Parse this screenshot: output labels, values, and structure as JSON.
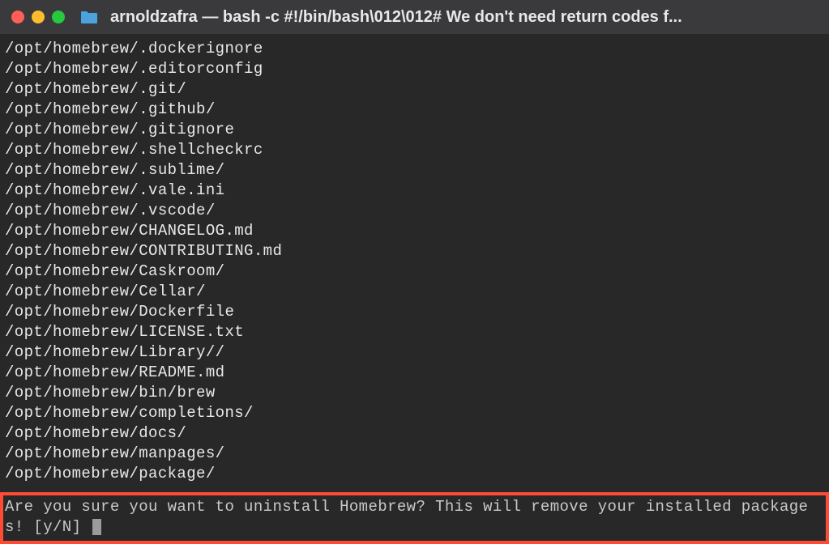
{
  "window": {
    "title": "arnoldzafra — bash -c #!/bin/bash\\012\\012# We don't need return codes f..."
  },
  "terminal": {
    "lines": [
      "/opt/homebrew/.dockerignore",
      "/opt/homebrew/.editorconfig",
      "/opt/homebrew/.git/",
      "/opt/homebrew/.github/",
      "/opt/homebrew/.gitignore",
      "/opt/homebrew/.shellcheckrc",
      "/opt/homebrew/.sublime/",
      "/opt/homebrew/.vale.ini",
      "/opt/homebrew/.vscode/",
      "/opt/homebrew/CHANGELOG.md",
      "/opt/homebrew/CONTRIBUTING.md",
      "/opt/homebrew/Caskroom/",
      "/opt/homebrew/Cellar/",
      "/opt/homebrew/Dockerfile",
      "/opt/homebrew/LICENSE.txt",
      "/opt/homebrew/Library//",
      "/opt/homebrew/README.md",
      "/opt/homebrew/bin/brew",
      "/opt/homebrew/completions/",
      "/opt/homebrew/docs/",
      "/opt/homebrew/manpages/",
      "/opt/homebrew/package/"
    ],
    "prompt": "Are you sure you want to uninstall Homebrew? This will remove your installed packages! [y/N] "
  }
}
